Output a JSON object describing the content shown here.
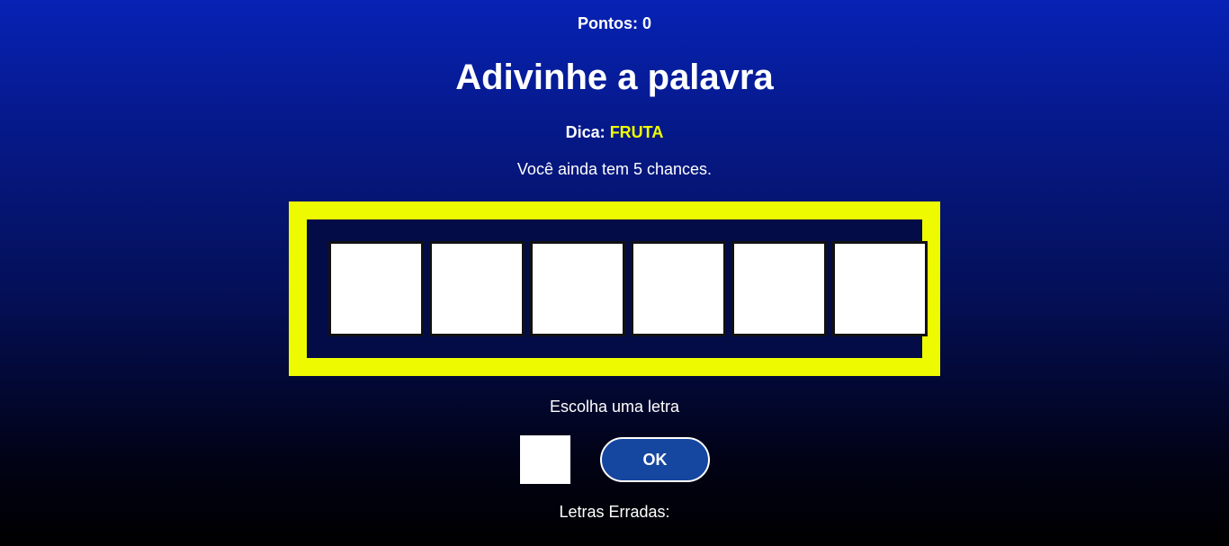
{
  "score": {
    "label": "Pontos:",
    "value": "0"
  },
  "title": "Adivinhe a palavra",
  "hint": {
    "label": "Dica:",
    "value": "FRUTA",
    "value_color": "#f0ff00"
  },
  "chances_text": "Você ainda tem 5 chances.",
  "board": {
    "border_color": "#eefa00",
    "slots": [
      "",
      "",
      "",
      "",
      "",
      ""
    ]
  },
  "input": {
    "label": "Escolha uma letra",
    "value": ""
  },
  "ok_button": {
    "label": "OK"
  },
  "wrong_letters": {
    "label": "Letras Erradas:",
    "letters": ""
  }
}
